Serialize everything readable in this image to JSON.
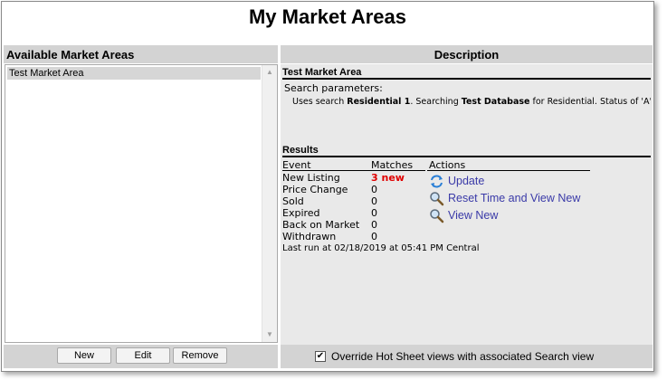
{
  "page": {
    "title": "My Market Areas"
  },
  "left_panel": {
    "header": "Available Market Areas",
    "items": [
      {
        "label": "Test Market Area",
        "selected": true
      }
    ],
    "buttons": {
      "new": "New",
      "edit": "Edit",
      "remove": "Remove"
    }
  },
  "right_panel": {
    "header": "Description",
    "area_name": "Test Market Area",
    "search_params_label": "Search parameters:",
    "search_params": {
      "prefix": "Uses search ",
      "search_name": "Residential 1",
      "mid": ". Searching ",
      "database": "Test Database",
      "suffix": " for Residential. Status of 'A'"
    },
    "results": {
      "title": "Results",
      "columns": {
        "event": "Event",
        "matches": "Matches",
        "actions": "Actions"
      },
      "rows": [
        {
          "event": "New Listing",
          "matches": "3 new"
        },
        {
          "event": "Price Change",
          "matches": "0"
        },
        {
          "event": "Sold",
          "matches": "0"
        },
        {
          "event": "Expired",
          "matches": "0"
        },
        {
          "event": "Back on Market",
          "matches": "0"
        },
        {
          "event": "Withdrawn",
          "matches": "0"
        }
      ],
      "actions": [
        {
          "label": "Update",
          "icon": "refresh-icon"
        },
        {
          "label": "Reset Time and View New",
          "icon": "magnifier-icon"
        },
        {
          "label": "View New",
          "icon": "magnifier-icon"
        }
      ],
      "last_run": "Last run at 02/18/2019 at 05:41 PM Central"
    },
    "override": {
      "label": "Override Hot Sheet views with associated Search view",
      "checked": true
    }
  },
  "colors": {
    "panel_header": "#d3d3d3",
    "body_bg": "#e9e9e9",
    "link": "#3a3aa8",
    "new_count": "#e00000"
  }
}
